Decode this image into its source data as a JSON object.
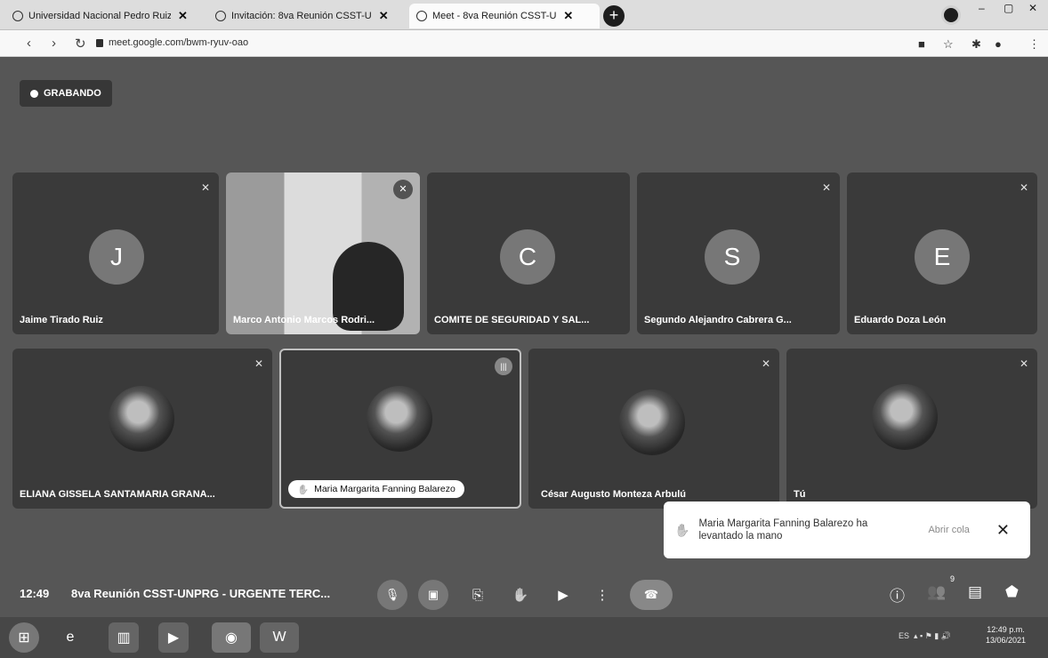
{
  "browser": {
    "tabs": [
      {
        "label": "Universidad Nacional Pedro Ruiz",
        "active": false
      },
      {
        "label": "Invitación: 8va Reunión CSST-U",
        "active": false
      },
      {
        "label": "Meet - 8va Reunión CSST-U",
        "active": true
      }
    ],
    "url": "meet.google.com/bwm-ryuv-oao"
  },
  "meet": {
    "recording_label": "GRABANDO",
    "participants": [
      {
        "name": "Jaime Tirado Ruiz",
        "initial": "J"
      },
      {
        "name": "Marco Antonio Marcos Rodri...",
        "initial": ""
      },
      {
        "name": "COMITE DE SEGURIDAD Y SAL...",
        "initial": "C"
      },
      {
        "name": "Segundo Alejandro Cabrera G...",
        "initial": "S"
      },
      {
        "name": "Eduardo Doza León",
        "initial": "E"
      },
      {
        "name": "ELIANA GISSELA SANTAMARIA GRANA...",
        "initial": ""
      },
      {
        "name": "Maria Margarita Fanning Balarezo",
        "initial": ""
      },
      {
        "name": "César Augusto Monteza Arbulú",
        "initial": ""
      },
      {
        "name": "Tú",
        "initial": ""
      }
    ],
    "toast": {
      "message": "Maria Margarita Fanning Balarezo ha levantado la mano",
      "action": "Abrir cola"
    },
    "bottom": {
      "time": "12:49",
      "meeting_title": "8va Reunión CSST-UNPRG - URGENTE TERC...",
      "people_count": "9"
    }
  },
  "taskbar": {
    "tray_lang": "ES",
    "time": "12:49 p.m.",
    "date": "13/06/2021"
  }
}
